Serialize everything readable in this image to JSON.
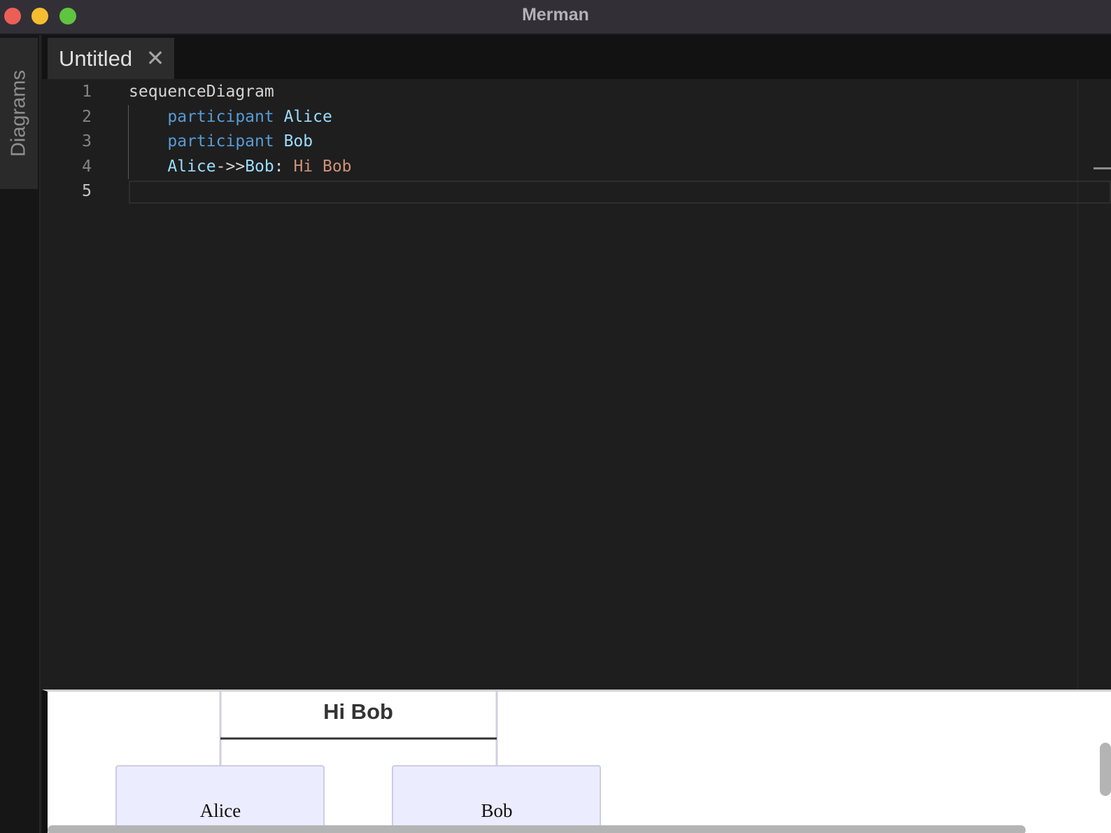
{
  "window": {
    "title": "Merman"
  },
  "sidebar": {
    "tab_label": "Diagrams"
  },
  "tabs": [
    {
      "label": "Untitled",
      "close_glyph": "✕"
    }
  ],
  "editor": {
    "active_line": 5,
    "lines": [
      {
        "number": "1",
        "tokens": [
          {
            "text": "sequenceDiagram",
            "kind": "plain"
          }
        ]
      },
      {
        "number": "2",
        "tokens": [
          {
            "text": "    ",
            "kind": "plain"
          },
          {
            "text": "participant",
            "kind": "kw"
          },
          {
            "text": " ",
            "kind": "plain"
          },
          {
            "text": "Alice",
            "kind": "ident"
          }
        ]
      },
      {
        "number": "3",
        "tokens": [
          {
            "text": "    ",
            "kind": "plain"
          },
          {
            "text": "participant",
            "kind": "kw"
          },
          {
            "text": " ",
            "kind": "plain"
          },
          {
            "text": "Bob",
            "kind": "ident"
          }
        ]
      },
      {
        "number": "4",
        "tokens": [
          {
            "text": "    ",
            "kind": "plain"
          },
          {
            "text": "Alice",
            "kind": "ident"
          },
          {
            "text": "->>",
            "kind": "plain"
          },
          {
            "text": "Bob",
            "kind": "ident"
          },
          {
            "text": ": ",
            "kind": "plain"
          },
          {
            "text": "Hi Bob",
            "kind": "str"
          }
        ]
      },
      {
        "number": "5",
        "tokens": []
      }
    ]
  },
  "preview": {
    "message_label": "Hi Bob",
    "participants": [
      "Alice",
      "Bob"
    ]
  },
  "colors": {
    "close": "#ec5f57",
    "minimize": "#f5bd30",
    "maximize": "#5fc43f",
    "keyword": "#569cd6",
    "identifier": "#9cdcfe",
    "string": "#ce9178",
    "participant_fill": "#ececff",
    "participant_stroke": "#9370db"
  }
}
